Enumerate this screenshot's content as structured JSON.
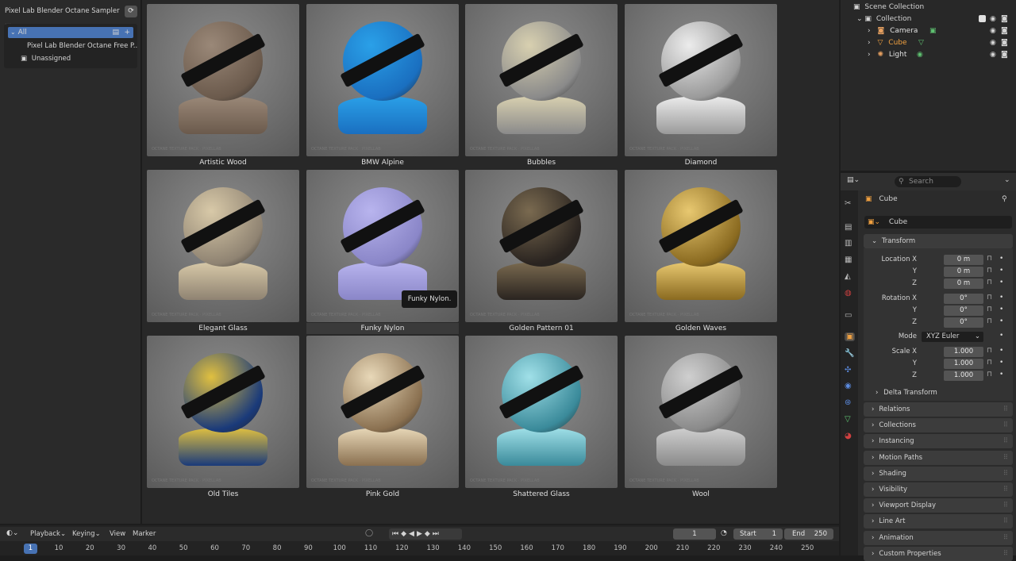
{
  "asset_browser": {
    "library": "Pixel Lab Blender Octane Sampler ...",
    "catalog_all": "All",
    "catalog_item": "Pixel Lab Blender Octane Free P...",
    "catalog_unassigned": "Unassigned",
    "tooltip": "Funky Nylon.",
    "assets": [
      {
        "name": "Artistic Wood",
        "colors": [
          "#6b5a4c",
          "#9a8878"
        ]
      },
      {
        "name": "BMW Alpine",
        "colors": [
          "#1a6fc0",
          "#2aa0e8"
        ]
      },
      {
        "name": "Bubbles",
        "colors": [
          "#8a8a8a",
          "#d8d0b0"
        ]
      },
      {
        "name": "Diamond",
        "colors": [
          "#9a9a9a",
          "#ececec"
        ]
      },
      {
        "name": "Elegant Glass",
        "colors": [
          "#8f8372",
          "#d8c9a8"
        ]
      },
      {
        "name": "Funky Nylon",
        "colors": [
          "#8a86c8",
          "#b8b4ee"
        ]
      },
      {
        "name": "Golden Pattern 01",
        "colors": [
          "#2a2420",
          "#7a6a50"
        ]
      },
      {
        "name": "Golden Waves",
        "colors": [
          "#8a6a20",
          "#e8c870"
        ]
      },
      {
        "name": "Old Tiles",
        "colors": [
          "#1a3a7a",
          "#e0c040"
        ]
      },
      {
        "name": "Pink Gold",
        "colors": [
          "#8a7050",
          "#e8d8b8"
        ]
      },
      {
        "name": "Shattered Glass",
        "colors": [
          "#3a8a9a",
          "#a0e0e8"
        ]
      },
      {
        "name": "Wool",
        "colors": [
          "#8a8a8a",
          "#cfcfcf"
        ]
      }
    ],
    "tile_footer": "OCTANE TEXTURE PACK · PIXELLAB"
  },
  "outliner": {
    "scene_collection": "Scene Collection",
    "collection": "Collection",
    "items": [
      {
        "label": "Camera",
        "color": "#e0e0e0"
      },
      {
        "label": "Cube",
        "color": "#f0a040"
      },
      {
        "label": "Light",
        "color": "#e0e0e0"
      }
    ]
  },
  "properties": {
    "search_placeholder": "Search",
    "object_name": "Cube",
    "datablock_name": "Cube",
    "transform_header": "Transform",
    "location_label": "Location X",
    "rotation_label": "Rotation X",
    "scale_label": "Scale X",
    "y_label": "Y",
    "z_label": "Z",
    "location": [
      "0 m",
      "0 m",
      "0 m"
    ],
    "rotation": [
      "0°",
      "0°",
      "0°"
    ],
    "scale": [
      "1.000",
      "1.000",
      "1.000"
    ],
    "mode_label": "Mode",
    "mode_value": "XYZ Euler",
    "delta_transform": "Delta Transform",
    "sections": [
      "Relations",
      "Collections",
      "Instancing",
      "Motion Paths",
      "Shading",
      "Visibility",
      "Viewport Display",
      "Line Art",
      "Animation",
      "Custom Properties"
    ]
  },
  "timeline": {
    "menu": [
      "Playback",
      "Keying",
      "View",
      "Marker"
    ],
    "current_frame": "1",
    "start_label": "Start",
    "start_value": "1",
    "end_label": "End",
    "end_value": "250",
    "marker_frame": "1",
    "ticks": [
      "10",
      "20",
      "30",
      "40",
      "50",
      "60",
      "70",
      "80",
      "90",
      "100",
      "110",
      "120",
      "130",
      "140",
      "150",
      "160",
      "170",
      "180",
      "190",
      "200",
      "210",
      "220",
      "230",
      "240",
      "250"
    ]
  }
}
